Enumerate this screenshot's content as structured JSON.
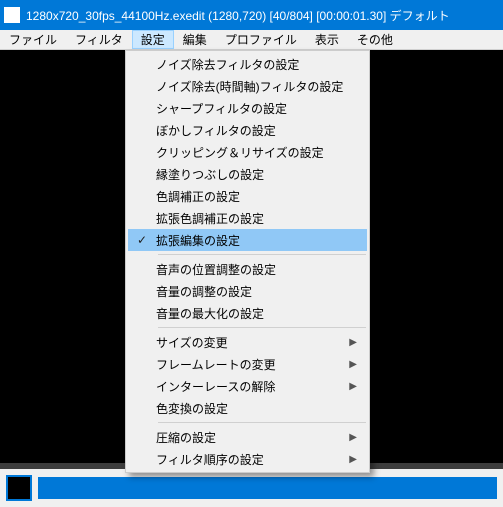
{
  "title": "1280x720_30fps_44100Hz.exedit (1280,720)  [40/804] [00:00:01.30]  デフォルト",
  "menubar": [
    "ファイル",
    "フィルタ",
    "設定",
    "編集",
    "プロファイル",
    "表示",
    "その他"
  ],
  "menubar_open_index": 2,
  "dropdown": {
    "g1": [
      "ノイズ除去フィルタの設定",
      "ノイズ除去(時間軸)フィルタの設定",
      "シャープフィルタの設定",
      "ぼかしフィルタの設定",
      "クリッピング＆リサイズの設定",
      "縁塗りつぶしの設定",
      "色調補正の設定",
      "拡張色調補正の設定",
      "拡張編集の設定"
    ],
    "g1_checked": 8,
    "g1_selected": 8,
    "g2": [
      "音声の位置調整の設定",
      "音量の調整の設定",
      "音量の最大化の設定"
    ],
    "g3": [
      {
        "label": "サイズの変更",
        "sub": true
      },
      {
        "label": "フレームレートの変更",
        "sub": true
      },
      {
        "label": "インターレースの解除",
        "sub": true
      },
      {
        "label": "色変換の設定",
        "sub": false
      }
    ],
    "g4": [
      {
        "label": "圧縮の設定",
        "sub": true
      },
      {
        "label": "フィルタ順序の設定",
        "sub": true
      }
    ]
  }
}
